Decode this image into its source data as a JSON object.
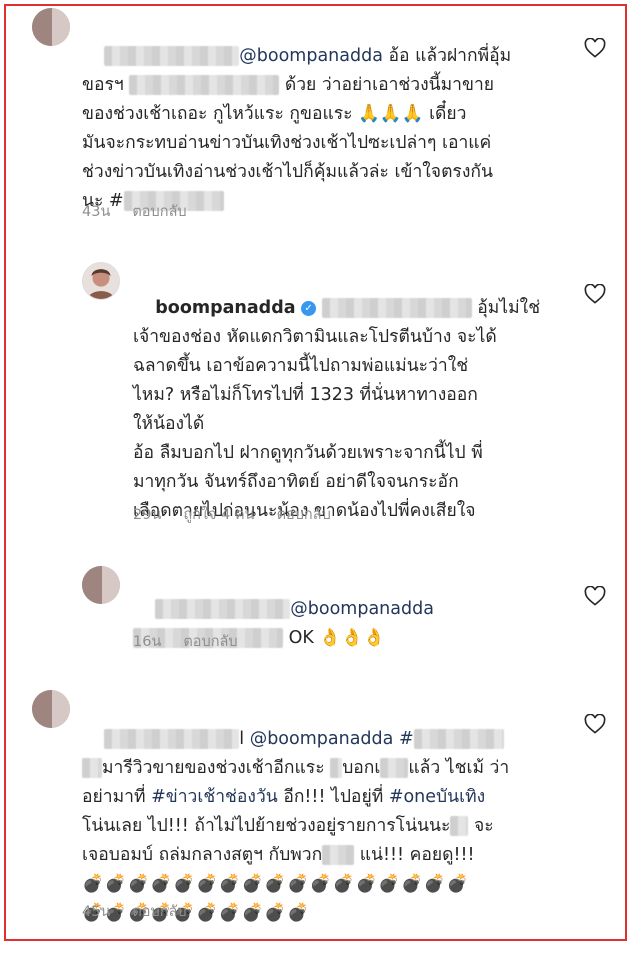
{
  "comments": [
    {
      "mention": "@boompanadda",
      "line1_rest": " อ้อ แล้วฝากพี่อุ้ม",
      "line2_pre": "ขอรฯ",
      "line2_post": "ด้วย ว่าอย่าเอาช่วงนี้มาขาย",
      "lines_mid": "ของช่วงเช้าเถอะ กูไหว้แระ กูขอแระ",
      "pray": "🙏🙏🙏",
      "line3_post": " เดี๋ยว",
      "lines_rest": "มันจะกระทบอ่านข่าวบันเทิงช่วงเช้าไปซะเปล่าๆ เอาแค่\nช่วงข่าวบันเทิงอ่านช่วงเช้าไปก็คุ้มแล้วล่ะ เข้าใจตรงกัน",
      "line_last_pre": "นะ #",
      "time": "43น",
      "reply": "ตอบกลับ"
    },
    {
      "username": "boompanadda",
      "verified_glyph": "✓",
      "line1_post": " อุ้มไม่ใช่",
      "text": "เจ้าของช่อง หัดแดกวิตามินและโปรตีนบ้าง จะได้\nฉลาดขึ้น เอาข้อความนี้ไปถามพ่อแม่นะว่าใช่\nไหม? หรือไม่ก็โทรไปที่ 1323 ที่นั่นหาทางออก\nให้น้องได้\nอ้อ ลืมบอกไป ฝากดูทุกวันด้วยเพราะจากนี้ไป พี่\nมาทุกวัน จันทร์ถึงอาทิตย์ อย่าดีใจจนกระอัก\nเลือดตายไปก่อนนะน้อง ขาดน้องไปพี่คงเสียใจ",
      "time": "29น",
      "likes": "ถูกใจ 4 คน",
      "reply": "ตอบกลับ"
    },
    {
      "mention": "@boompanadda",
      "line2": "OK",
      "ok_emoji": "👌👌👌",
      "time": "16น",
      "reply": "ตอบกลับ"
    },
    {
      "mention_pre": "l ",
      "mention": "@boompanadda",
      "hashtag_pre": " #",
      "line2": "มารีวิวขายของช่วงเช้าอีกแระ",
      "line2_b": "บอกเ",
      "line2_c": "แล้ว ไชเม้ ว่า",
      "line3_pre": "อย่ามาที่ ",
      "hashtag1": "#ข่าวเช้าช่องวัน",
      "line3_mid": " อีก!!! ไปอยู่ที่ ",
      "hashtag2": "#oneบันเทิง",
      "line4": "โน่นเลย ไป!!! ถ้าไม่ไปย้ายช่วงอยู่รายการโน่นนะ",
      "line4_post": " จะ",
      "line5_pre": "เจอบอมบ์ ถล่มกลางสตูฯ กับพวก",
      "line5_post": " แน่!!! คอยดู!!!",
      "bombs_row1": "💣💣💣💣💣💣💣💣💣💣💣💣💣💣💣💣💣",
      "bombs_row2": "💣💣💣💣💣💣💣💣💣💣",
      "time": "45น",
      "reply": "ตอบกลับ"
    }
  ],
  "icons": {
    "heart": "heart-outline-icon"
  },
  "colors": {
    "frame": "#e0302e",
    "mention": "#23375a",
    "meta": "#8e8e8e",
    "verified": "#3897f0"
  }
}
